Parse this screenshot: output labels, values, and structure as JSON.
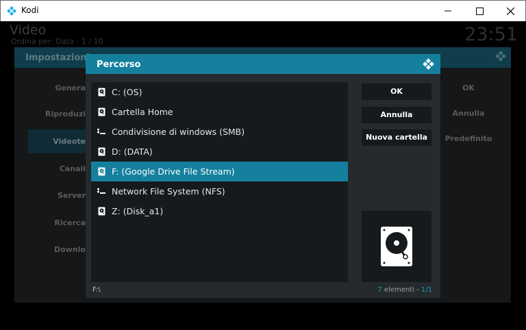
{
  "window": {
    "title": "Kodi"
  },
  "background": {
    "title": "Video",
    "subtitle": "Ordina per: Data - 1 / 10",
    "clock": "23:51",
    "panel_title": "Impostazioni",
    "categories": [
      "Genera",
      "Riproduzi",
      "Videote",
      "Canali",
      "Server",
      "Ricerca",
      "Downlo"
    ],
    "right_buttons": [
      "OK",
      "Annulla",
      "Predefinito"
    ]
  },
  "dialog": {
    "title": "Percorso",
    "items": [
      {
        "label": "C: (OS)",
        "icon": "hard-drive-icon"
      },
      {
        "label": "Cartella Home",
        "icon": "hard-drive-icon"
      },
      {
        "label": "Condivisione di windows (SMB)",
        "icon": "network-icon"
      },
      {
        "label": "D: (DATA)",
        "icon": "hard-drive-icon"
      },
      {
        "label": "F: (Google Drive File Stream)",
        "icon": "hard-drive-icon"
      },
      {
        "label": "Network File System (NFS)",
        "icon": "network-icon"
      },
      {
        "label": "Z: (Disk_a1)",
        "icon": "hard-drive-icon"
      }
    ],
    "selected_index": 4,
    "buttons": {
      "ok": "OK",
      "cancel": "Annulla",
      "new_folder": "Nuova cartella"
    },
    "current_path": "F:\\",
    "count": {
      "number": "7",
      "text": " elementi - ",
      "page": "1/1"
    }
  },
  "colors": {
    "accent": "#14809e",
    "dialog_bg": "#252a2d",
    "list_bg": "#161a1c"
  }
}
